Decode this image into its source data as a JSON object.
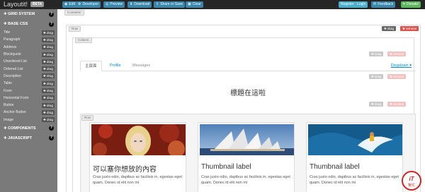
{
  "topbar": {
    "brand": "Layoutit!",
    "beta": "BETA",
    "buttons": {
      "edit": "Edit",
      "developer": "Developer",
      "preview": "Preview",
      "download": "Download",
      "share": "Share or Save",
      "clear": "Clear",
      "register": "Register · Login",
      "feedback": "Feedback",
      "donate": "Donate!"
    }
  },
  "sidebar": {
    "grid_system": "GRID SYSTEM",
    "base_css": "BASE CSS",
    "components": "COMPONENTS",
    "javascript": "JAVASCRIPT",
    "help": "?",
    "drag": "drag",
    "items": [
      "Title",
      "Paragraph",
      "Address",
      "Blockquote",
      "Unordered List",
      "Ordered List",
      "Description",
      "Table",
      "Form",
      "Horizontal Form",
      "Button",
      "Anchor Button",
      "Image"
    ]
  },
  "canvas": {
    "container_label": "Container",
    "row_label": "Row",
    "column_label": "Column",
    "drag": "drag",
    "remove": "remove",
    "tabs": [
      "主頁面",
      "Profile",
      "Messages"
    ],
    "dropdown": "Dropdown",
    "heading": "標題在這啦",
    "inner_row_label": "Row",
    "thumbnails": [
      {
        "title": "可以塞你想放的內容",
        "text": "Cras justo odio, dapibus ac facilisis in, egestas eget quam. Donec id elit non mi"
      },
      {
        "title": "Thumbnail label",
        "text": "Cras justo odio, dapibus ac facilisis in, egestas eget quam. Donec id elit non mi"
      },
      {
        "title": "Thumbnail label",
        "text": "Cras justo odio, dapibus ac facilisis in, egestas eget quam. Donec id elit non mi"
      }
    ]
  },
  "watermark": {
    "text": "iThome",
    "sub": "幫忙"
  },
  "colors": {
    "navbar": "#262626",
    "sidebar": "#7a7a7a",
    "primary": "#3a87ad",
    "danger": "#d9534f",
    "success": "#5bb75b"
  }
}
